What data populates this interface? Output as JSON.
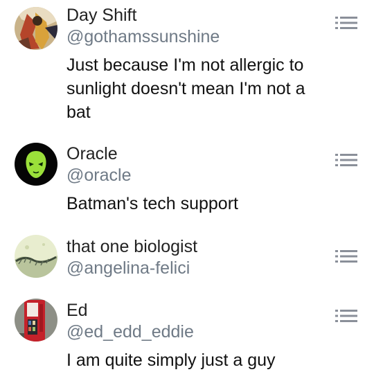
{
  "users": [
    {
      "name": "Day Shift",
      "handle": "@gothamssunshine",
      "bio": "Just because I'm not allergic to sunlight doesn't mean I'm not a bat",
      "avatar_icon": "comic-hero-avatar"
    },
    {
      "name": "Oracle",
      "handle": "@oracle",
      "bio": "Batman's tech support",
      "avatar_icon": "green-mask-avatar"
    },
    {
      "name": "that one biologist",
      "handle": "@angelina-felici",
      "bio": "",
      "avatar_icon": "microscope-slide-avatar"
    },
    {
      "name": "Ed",
      "handle": "@ed_edd_eddie",
      "bio": "I am quite simply just a guy",
      "avatar_icon": "vending-machine-avatar"
    }
  ],
  "menu_icon": "list-menu-icon"
}
